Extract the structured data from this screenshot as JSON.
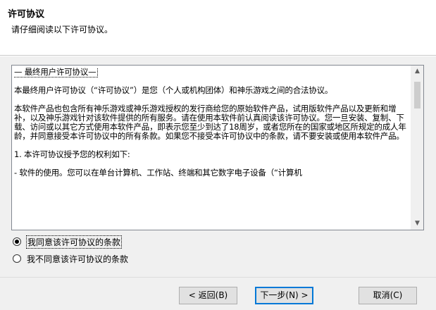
{
  "header": {
    "title": "许可协议",
    "subtitle": "请仔细阅读以下许可协议。"
  },
  "license": {
    "paragraphs": [
      "— 最终用户许可协议—",
      "本最终用户许可协议（“许可协议”）是您（个人或机构团体）和神乐游戏之间的合法协议。",
      "本软件产品也包含所有神乐游戏或神乐游戏授权的发行商给您的原始软件产品，试用版软件产品以及更新和增补，以及神乐游戏针对该软件提供的所有服务。请在使用本软件前认真阅读该许可协议。您一旦安装、复制、下载、访问或以其它方式使用本软件产品，即表示您至少到达了18周岁，或者您所在的国家或地区所规定的成人年龄，并同意接受本许可协议中的所有条款。如果您不接受本许可协议中的条款，请不要安装或使用本软件产品。",
      "1. 本许可协议授予您的权利如下:",
      "- 软件的使用。您可以在单台计算机、工作站、终端和其它数字电子设备（“计算机"
    ]
  },
  "options": {
    "accept": "我同意该许可协议的条款",
    "decline": "我不同意该许可协议的条款",
    "selected": "accept"
  },
  "buttons": {
    "back": "< 返回(B)",
    "next": "下一步(N) >",
    "cancel": "取消(C)"
  }
}
